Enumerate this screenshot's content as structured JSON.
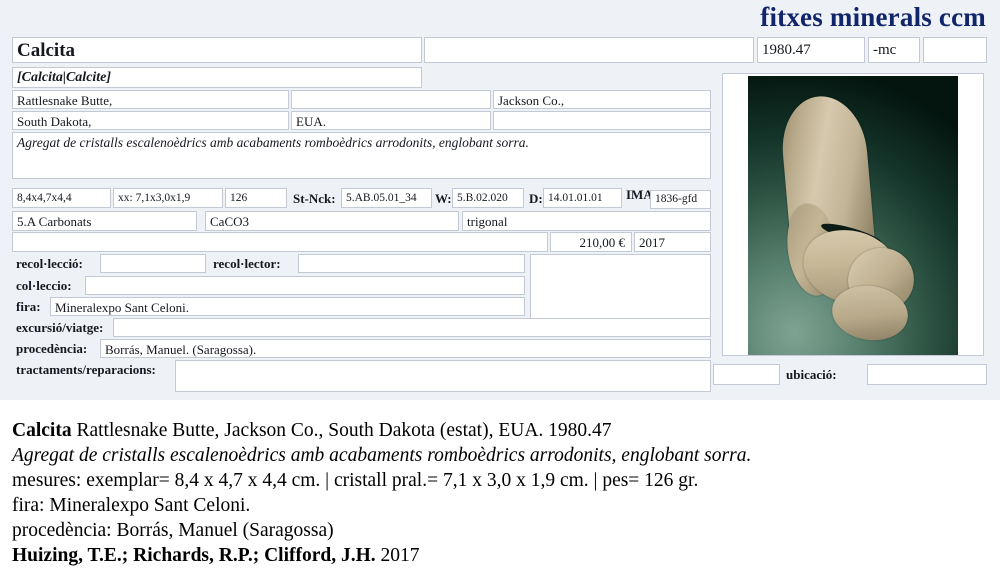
{
  "header": {
    "title": "fitxes minerals ccm",
    "title_color": "#11256b"
  },
  "form": {
    "name": "Calcita",
    "name_alt_empty": "",
    "catalog_number": "1980.47",
    "suffix_code": "-mc",
    "extra_code": "",
    "synonyms": "[Calcita|Calcite]",
    "locality_1": "Rattlesnake Butte,",
    "locality_2": "",
    "county": "Jackson Co.,",
    "state": "South Dakota,",
    "country": "EUA.",
    "region_extra": "",
    "description": "Agregat de cristalls escalenoèdrics amb acabaments romboèdrics arrodonits, englobant sorra.",
    "measure_specimen": "8,4x4,7x4,4",
    "measure_crystal": "xx: 7,1x3,0x1,9",
    "weight": "126",
    "strunz_nickel_label": "St-Nck:",
    "strunz_nickel": "5.AB.05.01_34",
    "w_label": "W:",
    "w_value": "5.B.02.020",
    "d_label": "D:",
    "d_value": "14.01.01.01",
    "ima_label": "IMA:",
    "ima_value": "1836-gfd",
    "class": "5.A Carbonats",
    "formula": "CaCO3",
    "crystal_system": "trigonal",
    "blank_wide": "",
    "price": "210,00 €",
    "year": "2017",
    "recollecio_label": "recol·lecció:",
    "recollecio_value": "",
    "recollector_label": "recol·lector:",
    "recollector_value": "",
    "collecio_label": "col·leccio:",
    "collecio_value": "",
    "fira_label": "fira:",
    "fira_value": "Mineralexpo Sant Celoni.",
    "excursio_label": "excursió/viatge:",
    "excursio_value": "",
    "procedencia_label": "procedència:",
    "procedencia_value": "Borrás, Manuel. (Saragossa).",
    "tractaments_label": "tractaments/reparacions:",
    "tractaments_value": "",
    "notes_panel_value": "",
    "small_box_value": "",
    "ubicacio_label": "ubicació:",
    "ubicacio_value": ""
  },
  "photo": {
    "alt": "calcite-specimen-photo",
    "background_color": "#2f5545",
    "crystal_color": "#c9bb9c"
  },
  "description_block": {
    "line1_bold": "Calcita",
    "line1_rest": " Rattlesnake Butte, Jackson Co., South Dakota (estat), EUA. 1980.47",
    "line2_italic": "Agregat de cristalls escalenoèdrics amb acabaments romboèdrics arrodonits, englobant sorra.",
    "line3": "mesures: exemplar= 8,4 x 4,7 x 4,4 cm. | cristall pral.= 7,1 x 3,0 x 1,9 cm. | pes= 126 gr.",
    "line4": "fira: Mineralexpo Sant Celoni.",
    "line5": "procedència: Borrás, Manuel (Saragossa)",
    "line6_bold": "Huizing, T.E.; Richards, R.P.; Clifford, J.H.",
    "line6_rest": " 2017"
  }
}
